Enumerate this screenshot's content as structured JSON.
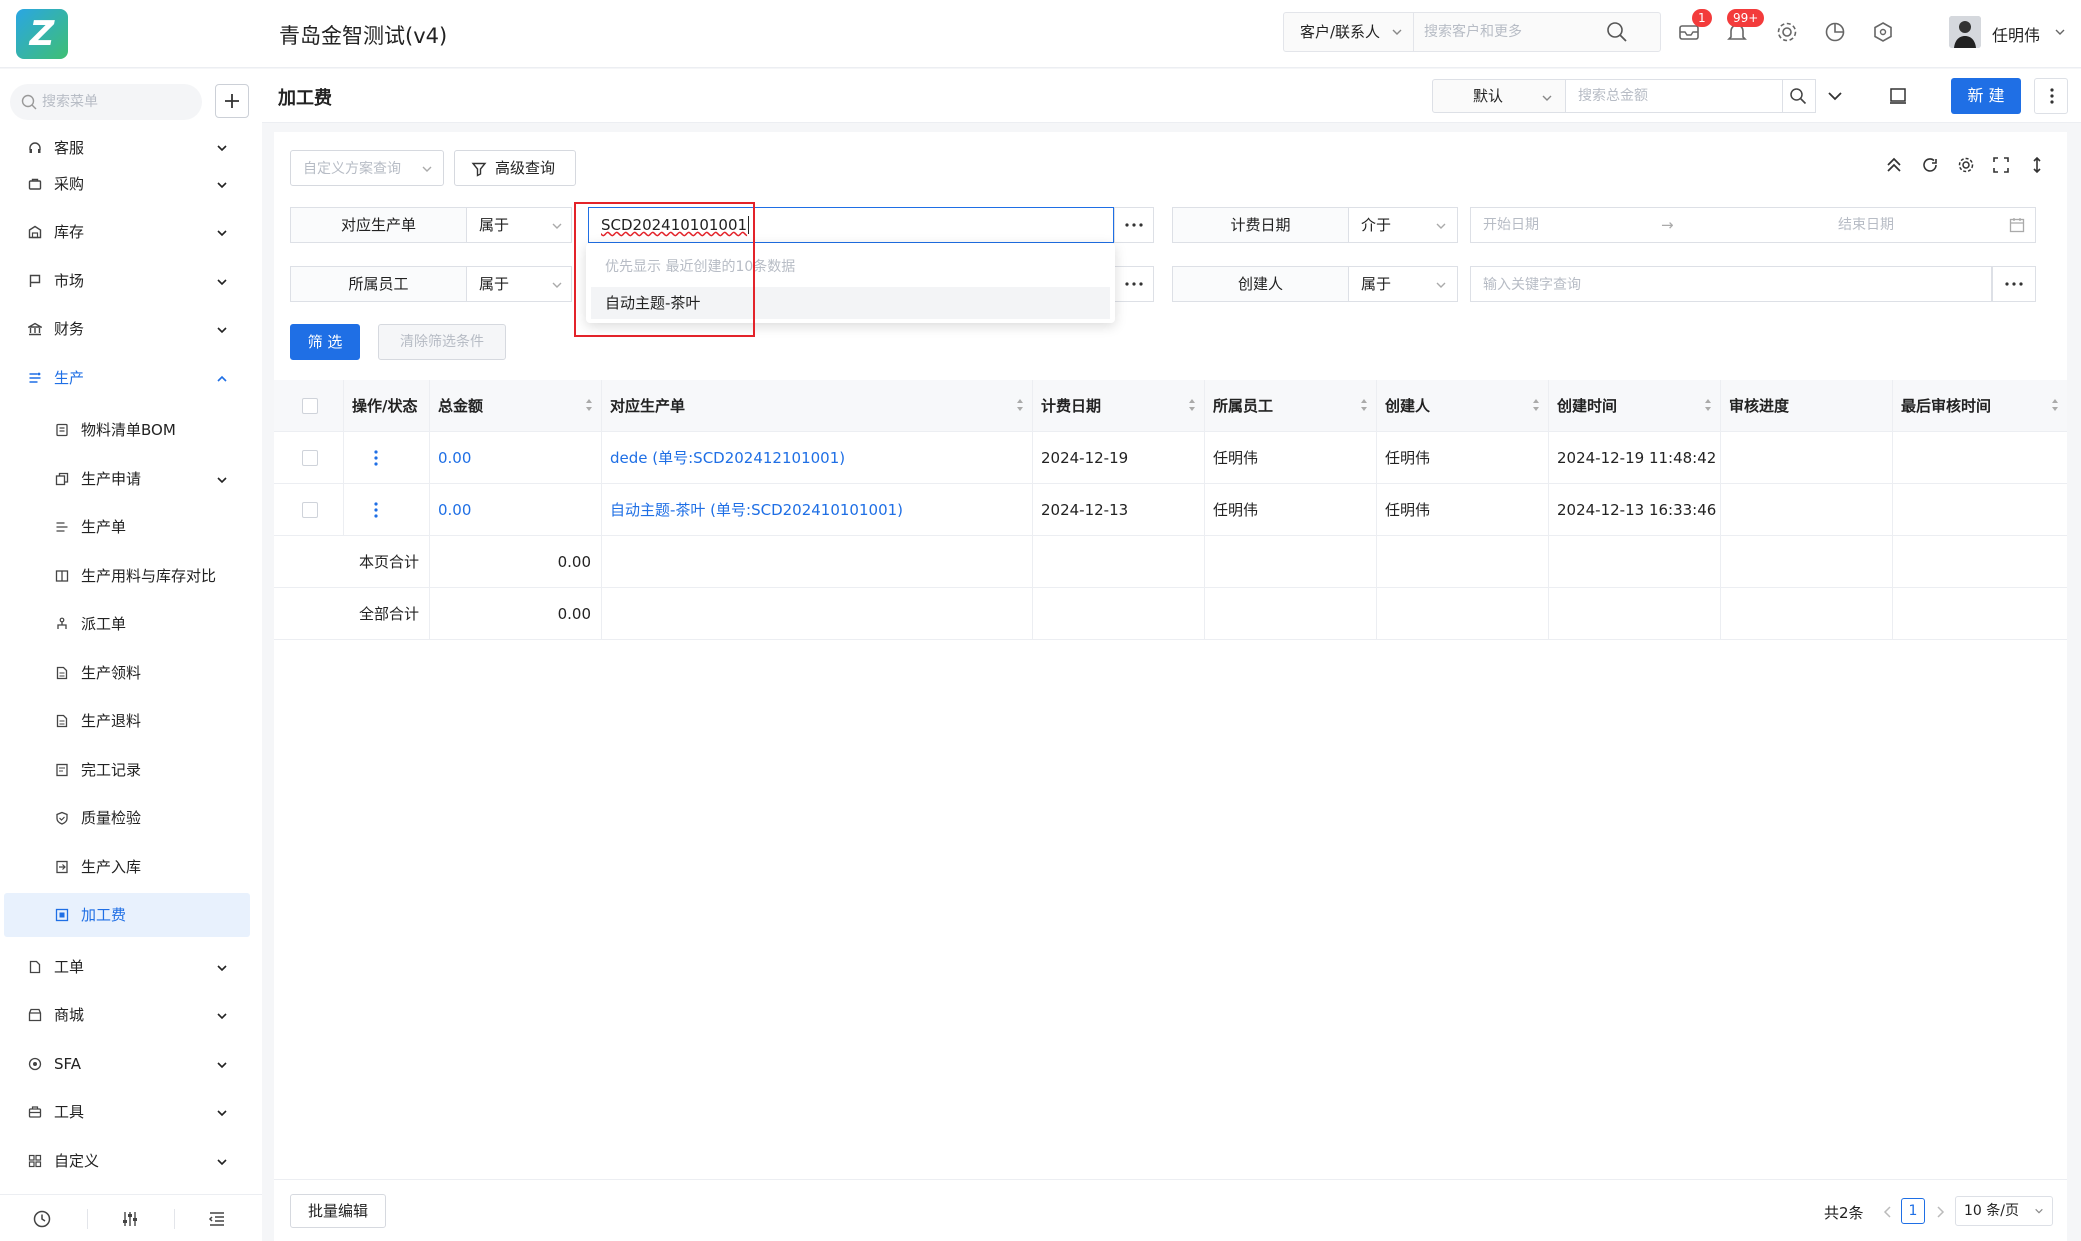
{
  "topbar": {
    "company": "青岛金智测试(v4)",
    "customer_select": "客户/联系人",
    "customer_placeholder": "搜索客户和更多",
    "mail_badge": "1",
    "notify_badge": "99+",
    "user_name": "任明伟"
  },
  "sidebar": {
    "search_placeholder": "搜索菜单",
    "items": [
      {
        "label": "客服",
        "icon": "headset-icon"
      },
      {
        "label": "采购",
        "icon": "cart-icon"
      },
      {
        "label": "库存",
        "icon": "warehouse-icon"
      },
      {
        "label": "市场",
        "icon": "flag-icon"
      },
      {
        "label": "财务",
        "icon": "bank-icon"
      },
      {
        "label": "生产",
        "icon": "production-icon"
      }
    ],
    "production_sub": [
      {
        "label": "物料清单BOM",
        "icon": "list-icon"
      },
      {
        "label": "生产申请",
        "icon": "copy-icon"
      },
      {
        "label": "生产单",
        "icon": "production-order-icon"
      },
      {
        "label": "生产用料与库存对比",
        "icon": "compare-icon"
      },
      {
        "label": "派工单",
        "icon": "dispatch-icon"
      },
      {
        "label": "生产领料",
        "icon": "doc-icon"
      },
      {
        "label": "生产退料",
        "icon": "doc-icon"
      },
      {
        "label": "完工记录",
        "icon": "record-icon"
      },
      {
        "label": "质量检验",
        "icon": "shield-check-icon"
      },
      {
        "label": "生产入库",
        "icon": "inbound-icon"
      },
      {
        "label": "加工费",
        "icon": "fee-icon"
      }
    ],
    "items_after": [
      {
        "label": "工单",
        "icon": "ticket-icon"
      },
      {
        "label": "商城",
        "icon": "store-icon"
      },
      {
        "label": "SFA",
        "icon": "sfa-icon"
      },
      {
        "label": "工具",
        "icon": "toolbox-icon"
      },
      {
        "label": "自定义",
        "icon": "grid-icon"
      }
    ]
  },
  "header": {
    "title": "加工费",
    "view_select": "默认",
    "search_placeholder": "搜索总金额",
    "new_button": "新 建"
  },
  "filters": {
    "custom_query_placeholder": "自定义方案查询",
    "advanced_query": "高级查询",
    "row1": {
      "label": "对应生产单",
      "op": "属于",
      "value": "SCD202410101001",
      "label2": "计费日期",
      "op2": "介于",
      "start_placeholder": "开始日期",
      "end_placeholder": "结束日期"
    },
    "row2": {
      "label": "所属员工",
      "op": "属于",
      "label2": "创建人",
      "op2": "属于",
      "keyword_placeholder": "输入关键字查询"
    },
    "filter_button": "筛 选",
    "clear_button": "清除筛选条件"
  },
  "dropdown": {
    "hint": "优先显示 最近创建的10条数据",
    "option": "自动主题-茶叶"
  },
  "table": {
    "columns": [
      "操作/状态",
      "总金额",
      "对应生产单",
      "计费日期",
      "所属员工",
      "创建人",
      "创建时间",
      "审核进度",
      "最后审核时间"
    ],
    "rows": [
      {
        "amount": "0.00",
        "order": "dede (单号:SCD202412101001)",
        "date": "2024-12-19",
        "employee": "任明伟",
        "creator": "任明伟",
        "created": "2024-12-19 11:48:42",
        "audit": "",
        "last_audit": ""
      },
      {
        "amount": "0.00",
        "order": "自动主题-茶叶 (单号:SCD202410101001)",
        "date": "2024-12-13",
        "employee": "任明伟",
        "creator": "任明伟",
        "created": "2024-12-13 16:33:46",
        "audit": "",
        "last_audit": ""
      }
    ],
    "page_total_label": "本页合计",
    "page_total": "0.00",
    "all_total_label": "全部合计",
    "all_total": "0.00"
  },
  "footer": {
    "batch_edit": "批量编辑",
    "total": "共2条",
    "page": "1",
    "page_size": "10 条/页"
  },
  "colors": {
    "accent": "#1f6fe5",
    "highlight_box": "#e3232a"
  }
}
